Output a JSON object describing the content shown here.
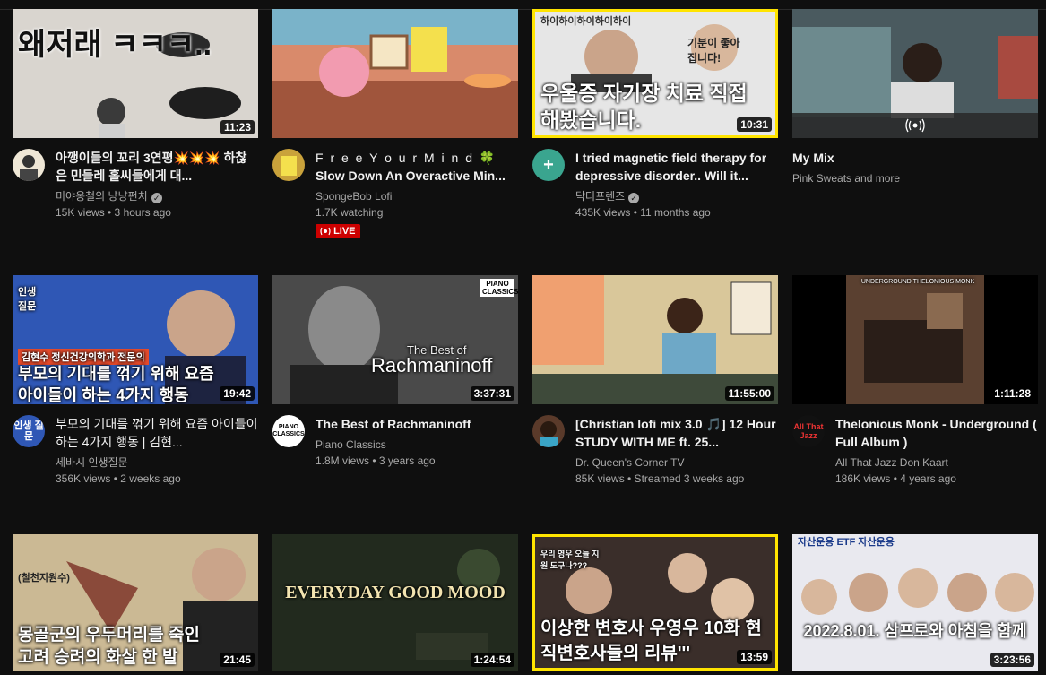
{
  "videos": [
    {
      "title": "아깽이들의 꼬리 3연평💥💥💥 하찮은 민들레 홀씨들에게 대...",
      "channel": "미야옹철의 냥냥펀치",
      "stats": "15K views • 3 hours ago",
      "duration": "11:23",
      "thumb_text": "왜저래 ㅋㅋㅋ..",
      "avatar_text": ""
    },
    {
      "title": "Slow Down An Overactive Min...",
      "subtitle": "F r e e  Y o u r  M i n d 🍀",
      "channel": "SpongeBob Lofi",
      "stats": "1.7K watching",
      "live": "LIVE",
      "avatar_text": ""
    },
    {
      "title": "I tried magnetic field therapy for depressive disorder.. Will it...",
      "channel": "닥터프렌즈",
      "stats": "435K views • 11 months ago",
      "duration": "10:31",
      "thumb_text": "우울증 자기장 치료 직접 해봤습니다.",
      "thumb_small": "하이하이하이하이하이",
      "thumb_small2": "기분이 좋아집니다!",
      "avatar_text": "+"
    },
    {
      "title": "My Mix",
      "channel": "Pink Sweats and more",
      "avatar_text": ""
    },
    {
      "title": "부모의 기대를 꺾기 위해 요즘 아이들이 하는 4가지 행동 | 김현...",
      "channel": "세바시 인생질문",
      "stats": "356K views • 2 weeks ago",
      "duration": "19:42",
      "thumb_text": "부모의 기대를 꺾기 위해 요즘 아이들이 하는 4가지 행동",
      "thumb_small": "김현수 정신건강의학과 전문의",
      "avatar_text": "인생 질문",
      "thumb_badge": "인생 질문"
    },
    {
      "title": "The Best of Rachmaninoff",
      "channel": "Piano Classics",
      "stats": "1.8M views • 3 years ago",
      "duration": "3:37:31",
      "thumb_small": "The Best of",
      "thumb_text": "Rachmaninoff",
      "thumb_badge": "PIANO CLASSICS",
      "avatar_text": "PIANO CLASSICS"
    },
    {
      "title": "[Christian lofi mix 3.0 🎵] 12 Hour STUDY WITH ME ft. 25...",
      "channel": "Dr. Queen's Corner TV",
      "stats": "85K views • Streamed 3 weeks ago",
      "duration": "11:55:00",
      "avatar_text": ""
    },
    {
      "title": "Thelonious Monk - Underground ( Full Album )",
      "channel": "All That Jazz Don Kaart",
      "stats": "186K views • 4 years ago",
      "duration": "1:11:28",
      "thumb_small": "UNDERGROUND THELONIOUS MONK",
      "avatar_text": "All That Jazz"
    },
    {
      "title": "",
      "channel": "",
      "stats": "",
      "duration": "21:45",
      "thumb_text": "몽골군의 우두머리를 죽인 고려 승려의 화살 한 발",
      "thumb_small": "(철천지원수)",
      "avatar_text": ""
    },
    {
      "title": "",
      "channel": "",
      "stats": "",
      "duration": "1:24:54",
      "thumb_text": "EVERYDAY GOOD MOOD",
      "avatar_text": ""
    },
    {
      "title": "",
      "channel": "",
      "stats": "",
      "duration": "13:59",
      "thumb_text": "이상한 변호사 우영우 10화 현직변호사들의 리뷰'''",
      "thumb_small": "우리 영우 오늘 지원 도구나???",
      "avatar_text": ""
    },
    {
      "title": "",
      "channel": "",
      "stats": "",
      "duration": "3:23:56",
      "thumb_text": "2022.8.01. 삼프로와 아침을 함께",
      "thumb_small": "자산운용 ETF 자산운용",
      "avatar_text": ""
    }
  ],
  "colors": {
    "accent_live": "#cc0000",
    "yellow_caption": "#ffe400",
    "bg": "#0f0f0f"
  }
}
